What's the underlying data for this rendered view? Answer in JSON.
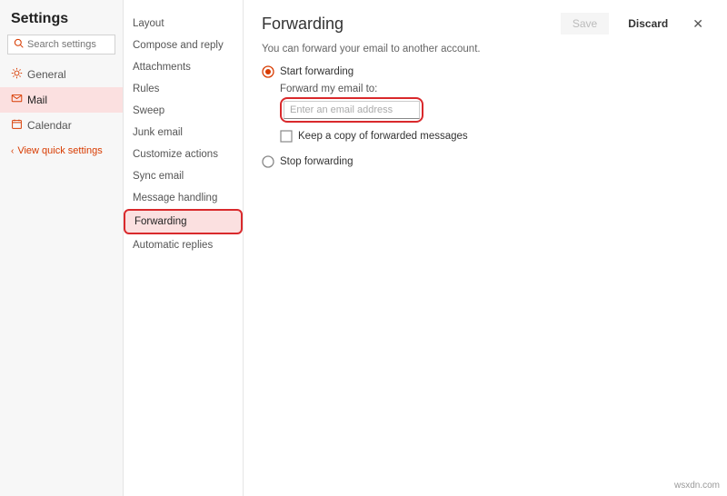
{
  "sidebar": {
    "title": "Settings",
    "search_placeholder": "Search settings",
    "items": [
      {
        "label": "General",
        "icon": "gear"
      },
      {
        "label": "Mail",
        "icon": "mail"
      },
      {
        "label": "Calendar",
        "icon": "calendar"
      }
    ],
    "quick_link": "View quick settings"
  },
  "subnav": {
    "items": [
      "Layout",
      "Compose and reply",
      "Attachments",
      "Rules",
      "Sweep",
      "Junk email",
      "Customize actions",
      "Sync email",
      "Message handling",
      "Forwarding",
      "Automatic replies"
    ]
  },
  "main": {
    "title": "Forwarding",
    "save_label": "Save",
    "discard_label": "Discard",
    "close_label": "✕",
    "description": "You can forward your email to another account.",
    "start_label": "Start forwarding",
    "forward_to_label": "Forward my email to:",
    "email_placeholder": "Enter an email address",
    "keep_copy_label": "Keep a copy of forwarded messages",
    "stop_label": "Stop forwarding"
  },
  "attribution": "wsxdn.com"
}
